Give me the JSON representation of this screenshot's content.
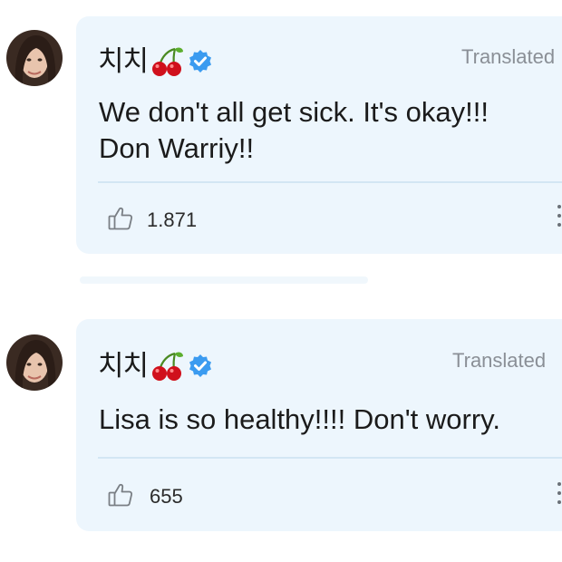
{
  "colors": {
    "card_background": "#edf6fd",
    "divider": "#d3e6f4",
    "verified_badge": "#3b9bf0",
    "cherry": "#d0101c",
    "muted_text": "#8a8f96"
  },
  "comments": [
    {
      "author": "치치",
      "author_emoji": "cherry-icon",
      "verified": true,
      "translated_label": "Translated",
      "text_lines": [
        "We don't all get sick. It's okay!!!",
        "Don Warriy!!"
      ],
      "likes": "1.871"
    },
    {
      "author": "치치",
      "author_emoji": "cherry-icon",
      "verified": true,
      "translated_label": "Translated",
      "text_lines": [
        "Lisa is so healthy!!!! Don't worry."
      ],
      "likes": "655"
    }
  ]
}
